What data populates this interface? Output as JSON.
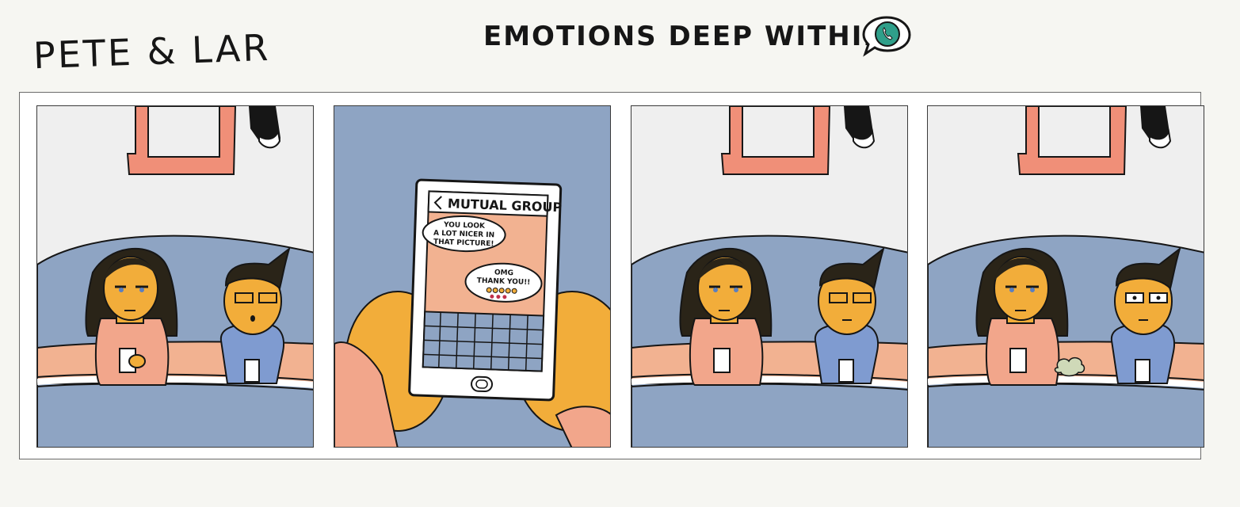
{
  "header": {
    "logo_text": "PETE & LAR",
    "title": "EMOTIONS DEEP WITHIN"
  },
  "panel2": {
    "chat_title": "MUTUAL GROUP",
    "message_1_lines": [
      "YOU LOOK",
      "A LOT NICER IN",
      "THAT PICTURE!"
    ],
    "message_2_lines": [
      "OMG",
      "THANK YOU!!"
    ]
  },
  "colors": {
    "page_bg": "#f6f6f2",
    "wall": "#efefef",
    "couch": "#8ea4c3",
    "skin_orange": "#f2ad3a",
    "pink_shirt": "#f2a68b",
    "blue_shirt": "#7f9bd0",
    "frame": "#f08f78",
    "logo_teal": "#2f9f8a"
  },
  "icons": {
    "title_icon": "phone-chat-bubble-icon",
    "back_icon": "chevron-left-icon",
    "home_button": "home-button-icon"
  }
}
